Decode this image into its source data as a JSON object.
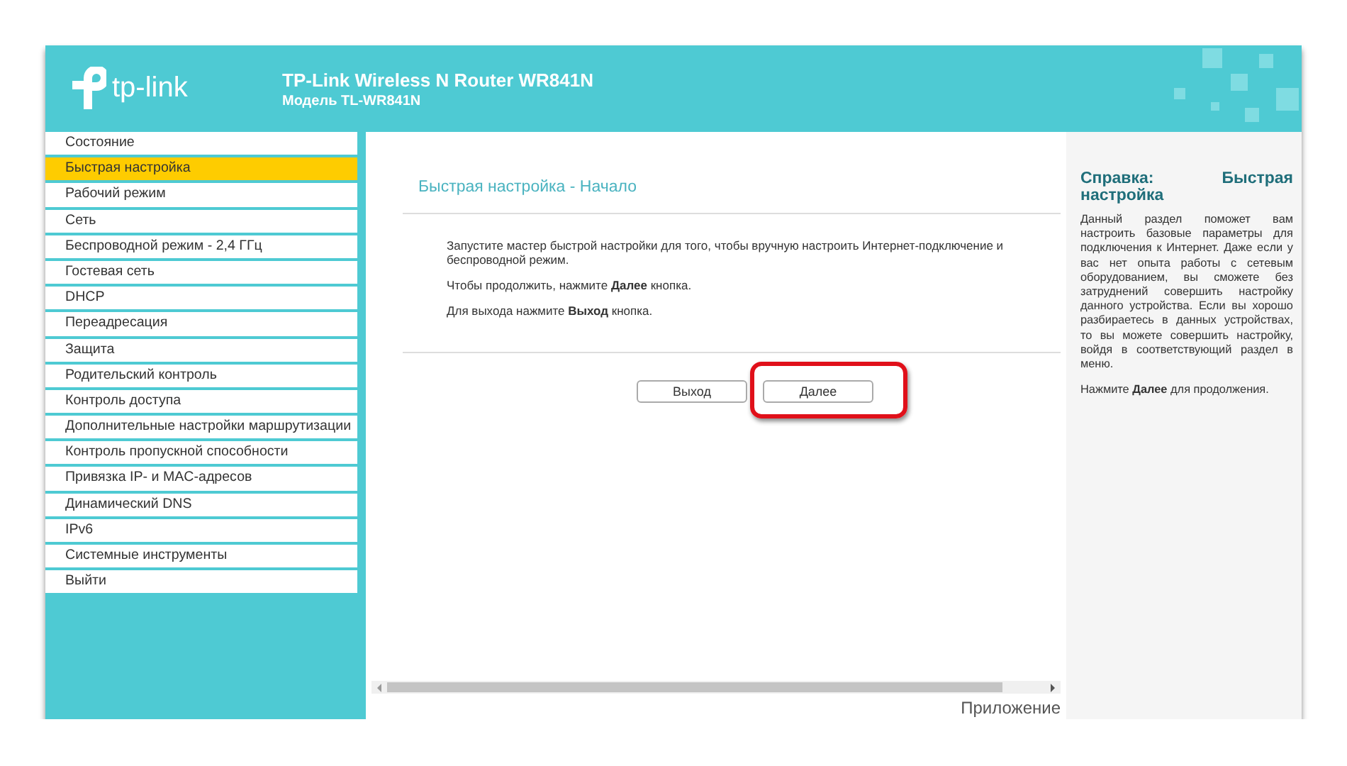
{
  "header": {
    "logo_text": "tp-link",
    "title": "TP-Link Wireless N Router WR841N",
    "model": "Модель TL-WR841N"
  },
  "sidebar": {
    "items": [
      {
        "label": "Состояние",
        "selected": false
      },
      {
        "label": "Быстрая настройка",
        "selected": true
      },
      {
        "label": "Рабочий режим",
        "selected": false
      },
      {
        "label": "Сеть",
        "selected": false
      },
      {
        "label": "Беспроводной режим - 2,4 ГГц",
        "selected": false
      },
      {
        "label": "Гостевая сеть",
        "selected": false
      },
      {
        "label": "DHCP",
        "selected": false
      },
      {
        "label": "Переадресация",
        "selected": false
      },
      {
        "label": "Защита",
        "selected": false
      },
      {
        "label": "Родительский контроль",
        "selected": false
      },
      {
        "label": "Контроль доступа",
        "selected": false
      },
      {
        "label": "Дополнительные настройки маршрутизации",
        "selected": false
      },
      {
        "label": "Контроль пропускной способности",
        "selected": false
      },
      {
        "label": "Привязка IP- и MAC-адресов",
        "selected": false
      },
      {
        "label": "Динамический DNS",
        "selected": false
      },
      {
        "label": "IPv6",
        "selected": false
      },
      {
        "label": "Системные инструменты",
        "selected": false
      },
      {
        "label": "Выйти",
        "selected": false
      }
    ]
  },
  "main": {
    "title": "Быстрая настройка - Начало",
    "paragraphs": [
      "Запустите мастер быстрой настройки для того, чтобы вручную настроить Интернет-подключение и беспроводной режим.",
      "Чтобы продолжить, нажмите **Далее** кнопка.",
      "Для выхода нажмите **Выход** кнопка."
    ],
    "buttons": [
      {
        "label": "Выход",
        "highlighted": false
      },
      {
        "label": "Далее",
        "highlighted": true
      }
    ],
    "footer_text": "Приложение"
  },
  "help": {
    "title": "Справка: Быстрая настройка",
    "paragraphs": [
      "Данный раздел поможет вам настроить базовые параметры для подключения к Интернет. Даже если у вас нет опыта работы с сетевым оборудованием, вы сможете без затруднений совершить настройку данного устройства. Если вы хорошо разбираетесь в данных устройствах, то вы можете совершить настройку, войдя в соответствующий раздел в меню.",
      "Нажмите **Далее** для продолжения."
    ]
  }
}
